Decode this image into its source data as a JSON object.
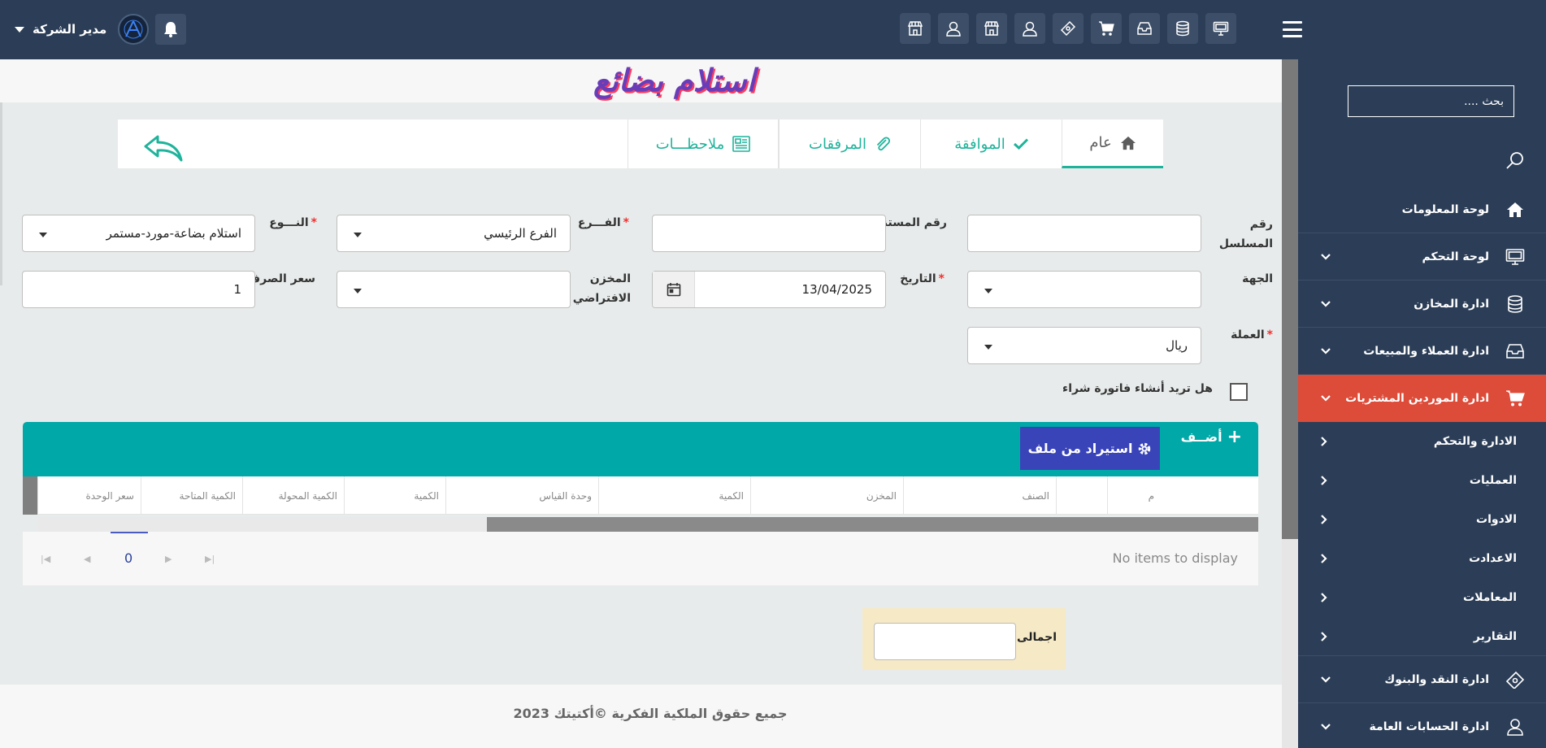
{
  "header": {
    "user_name": "مدير الشركة"
  },
  "sidebar": {
    "search_placeholder": "بحث ....",
    "menu": [
      {
        "label": "لوحة المعلومات"
      },
      {
        "label": "لوحة التحكم"
      },
      {
        "label": "ادارة المخازن"
      },
      {
        "label": "ادارة العملاء والمبيعات"
      },
      {
        "label": "ادارة الموردين المشتريات"
      }
    ],
    "submenu": [
      {
        "label": "الادارة والتحكم"
      },
      {
        "label": "العمليات"
      },
      {
        "label": "الادوات"
      },
      {
        "label": "الاعدادت"
      },
      {
        "label": "المعاملات"
      },
      {
        "label": "التقارير"
      }
    ],
    "menu_bottom": [
      {
        "label": "ادارة النقد والبنوك"
      },
      {
        "label": "ادارة الحسابات العامة"
      }
    ]
  },
  "page": {
    "title": "استلام بضائع"
  },
  "tabs": [
    {
      "label": "عام"
    },
    {
      "label": "الموافقة"
    },
    {
      "label": "المرفقات"
    },
    {
      "label": "ملاحظـــات"
    }
  ],
  "form": {
    "serial": {
      "label_line1": "رقم",
      "label_line2": "المسلسل",
      "value": ""
    },
    "doc_number": {
      "label": "رقم المستند",
      "value": ""
    },
    "branch": {
      "label": "الفـــرع",
      "required_mark": "*",
      "value": "الفرع الرئيسي"
    },
    "type": {
      "label": "النـــوع",
      "required_mark": "*",
      "value": "استلام بضاعة-مورد-مستمر"
    },
    "party": {
      "label": "الجهة",
      "value": ""
    },
    "date": {
      "label": "التاريخ",
      "required_mark": "*",
      "value": "13/04/2025"
    },
    "default_store": {
      "label_line1": "المخزن",
      "label_line2": "الافتراضي",
      "value": ""
    },
    "exchange_rate": {
      "label": "سعر الصرف",
      "value": "1"
    },
    "currency": {
      "label": "العملة",
      "required_mark": "*",
      "value": "ريال"
    },
    "create_invoice_label": "هل تريد أنشاء فاتورة شراء"
  },
  "grid": {
    "add_label": "أضــف",
    "import_label": "استيراد من ملف",
    "columns": [
      "م",
      "الصنف",
      "المخزن",
      "الكمية",
      "وحدة القياس",
      "الكمية",
      "الكمية المحولة",
      "الكمية المتاحة",
      "سعر الوحدة"
    ],
    "page_number": "0",
    "empty_text": "No items to display"
  },
  "totals": {
    "label": "اجمالى",
    "value": ""
  },
  "footer": {
    "copyright": "جميع حقوق الملكية الفكرية ©أكتيتك 2023"
  },
  "colors": {
    "sidebar_bg": "#2c3e57",
    "active_menu": "#dd4b39",
    "accent_teal": "#00a8a8",
    "import_button": "#3a44b9"
  }
}
